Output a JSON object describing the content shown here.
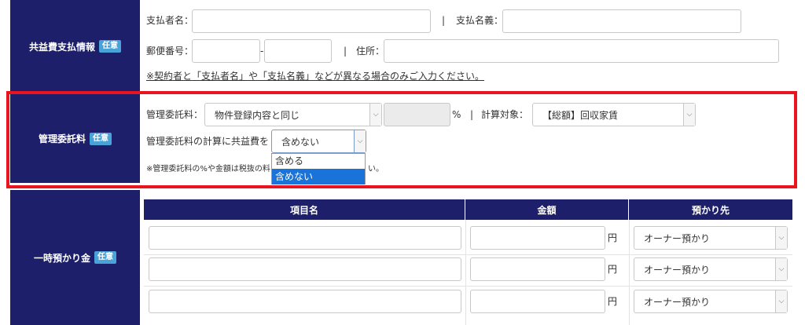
{
  "badge": "任意",
  "utility": {
    "heading": "共益費支払情報",
    "payer_name_label": "支払者名：",
    "sep": "|",
    "payer_title_label": "支払名義：",
    "postal_label": "郵便番号：",
    "postal_dash": "-",
    "address_label": "住所：",
    "note": "※契約者と「支払者名」や「支払名義」などが異なる場合のみご入力ください。"
  },
  "mgmt": {
    "heading": "管理委託料",
    "fee_label": "管理委託料：",
    "fee_select_value": "物件登録内容と同じ",
    "percent": "%",
    "sep": "|",
    "target_label": "計算対象：",
    "target_select_value": "【総額】回収家賃",
    "include_label": "管理委託料の計算に共益費を",
    "include_select_value": "含めない",
    "dropdown_options": [
      "含める",
      "含めない"
    ],
    "note_start": "※管理委託料の%や金額は税抜の料",
    "note_end": "い。",
    "highlight_color": "#e8141f"
  },
  "deposit": {
    "heading": "一時預かり金",
    "columns": [
      "項目名",
      "金額",
      "預かり先"
    ],
    "yen": "円",
    "rows": [
      {
        "holder": "オーナー預かり"
      },
      {
        "holder": "オーナー預かり"
      },
      {
        "holder": "オーナー預かり"
      }
    ]
  }
}
